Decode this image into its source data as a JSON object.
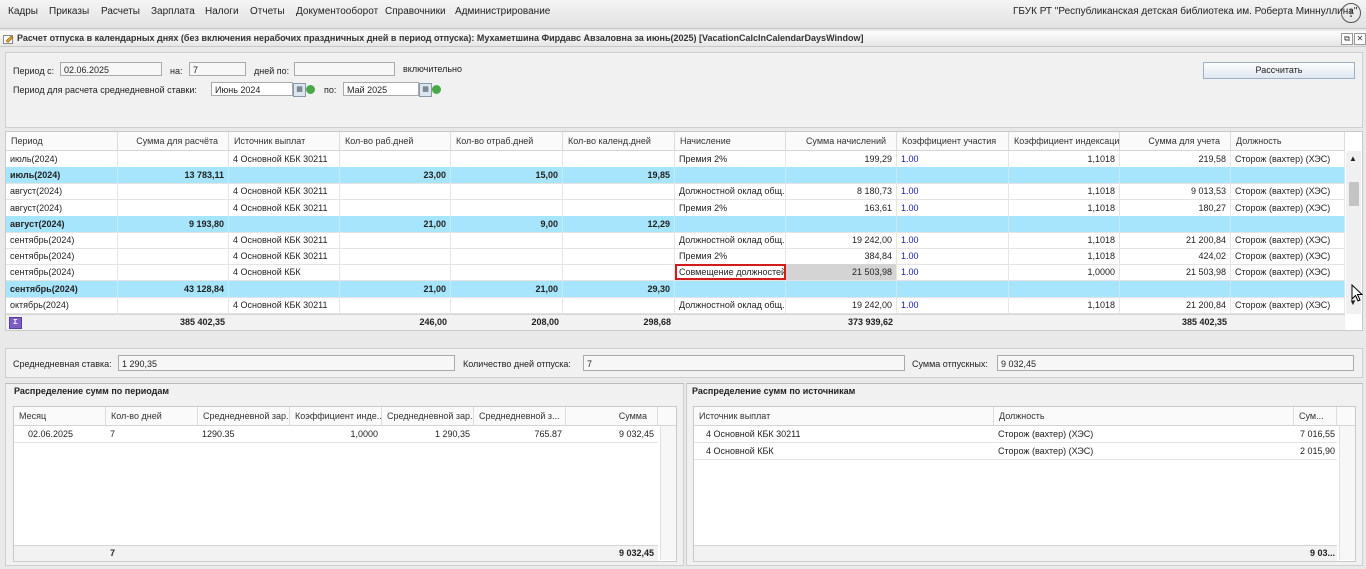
{
  "menu": [
    "Кадры",
    "Приказы",
    "Расчеты",
    "Зарплата",
    "Налоги",
    "Отчеты",
    "Документооборот",
    "Справочники",
    "Администрирование"
  ],
  "org": "ГБУК РТ \"Республиканская детская библиотека им. Роберта Миннуллина\"",
  "alert_icon": "!",
  "window": {
    "title": "Расчет отпуска в календарных днях (без включения нерабочих праздничных дней в период отпуска): Мухаметшина Фирдавс Авзаловна за июнь(2025) [VacationCalcInCalendarDaysWindow]",
    "restore": "⧉",
    "close": "✕"
  },
  "form": {
    "period_from_label": "Период с:",
    "period_from": "02.06.2025",
    "days_label": "на:",
    "days": "7",
    "period_to_label": "дней по:",
    "period_to": "",
    "inclusive_label": "включительно",
    "avg_period_label": "Период для расчета среднедневной ставки:",
    "avg_from": "Июнь 2024",
    "avg_to_label": "по:",
    "avg_to": "Май 2025",
    "calc_button": "Рассчитать"
  },
  "grid": {
    "columns": [
      "Период",
      "Сумма для расчёта",
      "Источник выплат",
      "Кол-во раб.дней",
      "Кол-во отраб.дней",
      "Кол-во календ.дней",
      "Начисление",
      "Сумма начислений",
      "Коэффициент участия",
      "Коэффициент индексации",
      "Сумма для учета",
      "Должность"
    ],
    "rows": [
      {
        "group": false,
        "cells": [
          "июль(2024)",
          "",
          "4 Основной КБК 30211",
          "",
          "",
          "",
          "Премия 2%",
          "199,29",
          "1.00",
          "1,1018",
          "219,58",
          "Сторож (вахтер) (ХЭС)"
        ]
      },
      {
        "group": true,
        "cells": [
          "июль(2024)",
          "13 783,11",
          "",
          "23,00",
          "15,00",
          "19,85",
          "",
          "",
          "",
          "",
          "",
          ""
        ]
      },
      {
        "group": false,
        "cells": [
          "август(2024)",
          "",
          "4 Основной КБК 30211",
          "",
          "",
          "",
          "Должностной оклад общ...",
          "8 180,73",
          "1.00",
          "1,1018",
          "9 013,53",
          "Сторож (вахтер) (ХЭС)"
        ]
      },
      {
        "group": false,
        "cells": [
          "август(2024)",
          "",
          "4 Основной КБК 30211",
          "",
          "",
          "",
          "Премия 2%",
          "163,61",
          "1.00",
          "1,1018",
          "180,27",
          "Сторож (вахтер) (ХЭС)"
        ]
      },
      {
        "group": true,
        "cells": [
          "август(2024)",
          "9 193,80",
          "",
          "21,00",
          "9,00",
          "12,29",
          "",
          "",
          "",
          "",
          "",
          ""
        ]
      },
      {
        "group": false,
        "cells": [
          "сентябрь(2024)",
          "",
          "4 Основной КБК 30211",
          "",
          "",
          "",
          "Должностной оклад общ...",
          "19 242,00",
          "1.00",
          "1,1018",
          "21 200,84",
          "Сторож (вахтер) (ХЭС)"
        ]
      },
      {
        "group": false,
        "cells": [
          "сентябрь(2024)",
          "",
          "4 Основной КБК 30211",
          "",
          "",
          "",
          "Премия 2%",
          "384,84",
          "1.00",
          "1,1018",
          "424,02",
          "Сторож (вахтер) (ХЭС)"
        ]
      },
      {
        "group": false,
        "selected": true,
        "cells": [
          "сентябрь(2024)",
          "",
          "4 Основной КБК",
          "",
          "",
          "",
          "Совмещение должностей...",
          "21 503,98",
          "1.00",
          "1,0000",
          "21 503,98",
          "Сторож (вахтер) (ХЭС)"
        ]
      },
      {
        "group": true,
        "cells": [
          "сентябрь(2024)",
          "43 128,84",
          "",
          "21,00",
          "21,00",
          "29,30",
          "",
          "",
          "",
          "",
          "",
          ""
        ]
      },
      {
        "group": false,
        "cells": [
          "октябрь(2024)",
          "",
          "4 Основной КБК 30211",
          "",
          "",
          "",
          "Должностной оклад общ...",
          "19 242,00",
          "1.00",
          "1,1018",
          "21 200,84",
          "Сторож (вахтер) (ХЭС)"
        ]
      }
    ],
    "totals": [
      "",
      "385 402,35",
      "",
      "246,00",
      "208,00",
      "298,68",
      "",
      "373 939,62",
      "",
      "",
      "385 402,35",
      ""
    ],
    "sum_icon": "Σ",
    "scroll_up": "▲",
    "scroll_down": "▼"
  },
  "stats": {
    "avg_rate_label": "Среднедневная ставка:",
    "avg_rate": "1 290,35",
    "vacation_days_label": "Количество дней отпуска:",
    "vacation_days": "7",
    "vacation_sum_label": "Сумма отпускных:",
    "vacation_sum": "9 032,45"
  },
  "periods": {
    "title": "Распределение сумм по периодам",
    "columns": [
      "Месяц",
      "Кол-во дней",
      "Среднедневной зар...",
      "Коэффициент инде...",
      "Среднедневной зар...",
      "Среднедневной з...",
      "Сумма"
    ],
    "rows": [
      [
        "02.06.2025",
        "7",
        "1290.35",
        "1,0000",
        "1 290,35",
        "765.87",
        "9 032,45"
      ]
    ],
    "totals": [
      "",
      "7",
      "",
      "",
      "",
      "",
      "9 032,45"
    ]
  },
  "sources": {
    "title": "Распределение сумм по источникам",
    "columns": [
      "Источник выплат",
      "Должность",
      "Сум..."
    ],
    "rows": [
      [
        "4 Основной КБК 30211",
        "Сторож (вахтер) (ХЭС)",
        "7 016,55"
      ],
      [
        "4 Основной КБК",
        "Сторож (вахтер) (ХЭС)",
        "2 015,90"
      ]
    ],
    "totals": [
      "",
      "",
      "9 03..."
    ]
  }
}
